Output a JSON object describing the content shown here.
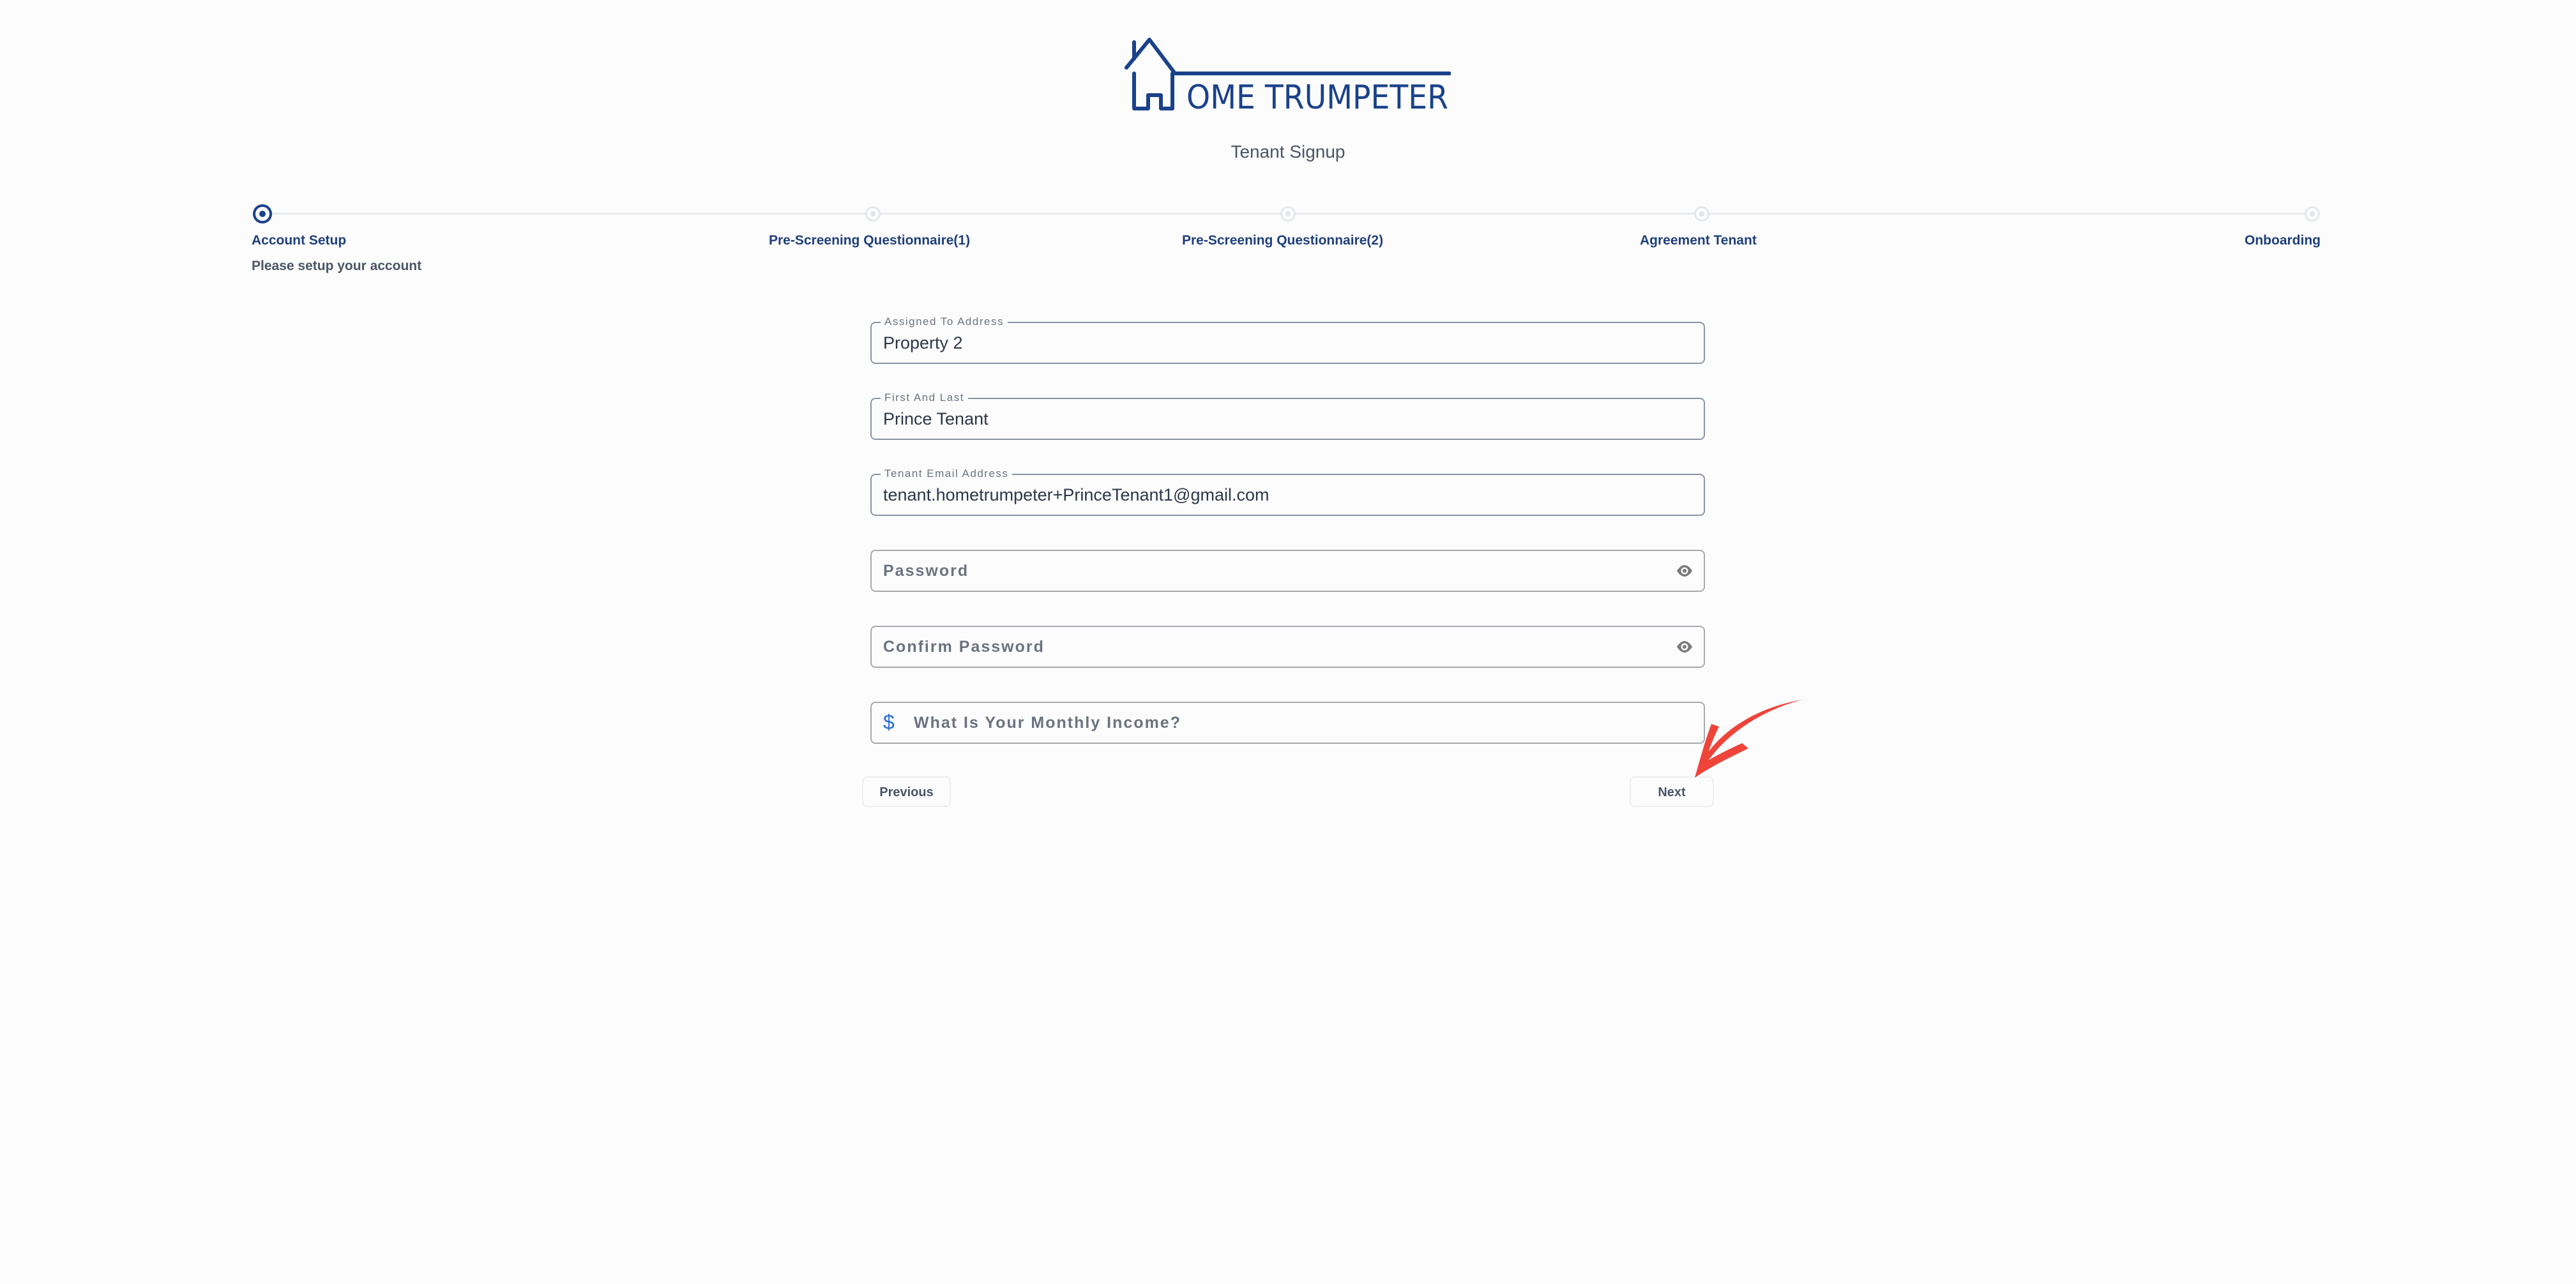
{
  "brand": {
    "logo_text": "OME TRUMPETER",
    "logo_color": "#1a428a"
  },
  "page": {
    "subtitle": "Tenant Signup"
  },
  "stepper": {
    "steps": [
      {
        "label": "Account Setup",
        "description": "Please setup your account",
        "state": "active"
      },
      {
        "label": "Pre-Screening Questionnaire(1)",
        "state": "pending"
      },
      {
        "label": "Pre-Screening Questionnaire(2)",
        "state": "pending"
      },
      {
        "label": "Agreement Tenant",
        "state": "pending"
      },
      {
        "label": "Onboarding",
        "state": "pending"
      }
    ]
  },
  "form": {
    "address": {
      "label": "Assigned To Address",
      "value": "Property 2"
    },
    "name": {
      "label": "First And Last",
      "value": "Prince Tenant"
    },
    "email": {
      "label": "Tenant Email Address",
      "value": "tenant.hometrumpeter+PrinceTenant1@gmail.com"
    },
    "password": {
      "placeholder": "Password",
      "icon": "eye-icon"
    },
    "confirm_password": {
      "placeholder": "Confirm Password",
      "icon": "eye-icon"
    },
    "income": {
      "placeholder": "What Is Your Monthly Income?",
      "icon": "dollar-icon",
      "icon_glyph": "$"
    }
  },
  "buttons": {
    "previous": "Previous",
    "next": "Next"
  },
  "annotation": {
    "type": "arrow-pointer",
    "color": "#ef443a",
    "target": "next-button"
  }
}
